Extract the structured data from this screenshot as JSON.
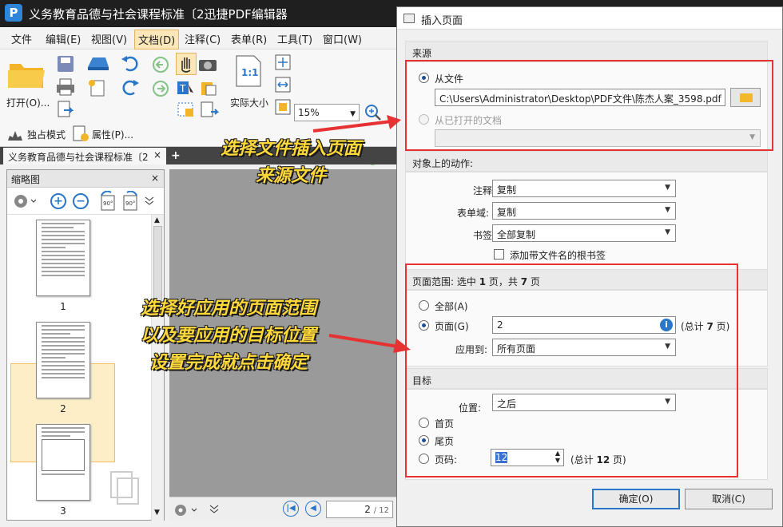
{
  "app": {
    "title": "义务教育品德与社会课程标准〔2迅捷PDF编辑器",
    "logo_glyph": "P"
  },
  "menu": [
    {
      "label": "文件"
    },
    {
      "label": "编辑(E)"
    },
    {
      "label": "视图(V)"
    },
    {
      "label": "文档(D)"
    },
    {
      "label": "注释(C)"
    },
    {
      "label": "表单(R)"
    },
    {
      "label": "工具(T)"
    },
    {
      "label": "窗口(W)"
    }
  ],
  "ribbon": {
    "open_label": "打开(O)...",
    "actual_size_glyph": "1:1",
    "actual_size_label": "实际大小",
    "zoom_value": "15%",
    "zoom_in_label": "放大",
    "zoom_out_label": "缩小",
    "exclusive_mode_label": "独占模式",
    "properties_label": "属性(P)..."
  },
  "doc_tab": {
    "label": "义务教育品德与社会课程标准〔2",
    "close": "×",
    "new_tab": "+"
  },
  "thumbnail_pane": {
    "title": "缩略图",
    "close": "×",
    "pages": [
      {
        "num": "1"
      },
      {
        "num": "2"
      },
      {
        "num": "3"
      }
    ]
  },
  "bottom_bar": {
    "page_current": "2",
    "page_total": "/ 12"
  },
  "dialog": {
    "title": "插入页面",
    "source": {
      "header": "来源",
      "from_file_label": "从文件",
      "file_path": "C:\\Users\\Administrator\\Desktop\\PDF文件\\陈杰人案_3598.pdf",
      "from_open_label": "从已打开的文档"
    },
    "actions": {
      "header": "对象上的动作:",
      "annot_label": "注释:",
      "annot_value": "复制",
      "form_label": "表单域:",
      "form_value": "复制",
      "bookmark_label": "书签:",
      "bookmark_value": "全部复制",
      "root_bookmark_label": "添加带文件名的根书签"
    },
    "range": {
      "header_prefix": "页面范围: 选中 ",
      "header_sel": "1",
      "header_mid": " 页，共 ",
      "header_total": "7",
      "header_suffix": " 页",
      "all_label": "全部(A)",
      "pages_label": "页面(G)",
      "pages_value": "2",
      "pages_total_prefix": "(总计 ",
      "pages_total": "7",
      "pages_total_suffix": " 页)",
      "apply_label": "应用到:",
      "apply_value": "所有页面"
    },
    "target": {
      "header": "目标",
      "position_label": "位置:",
      "position_value": "之后",
      "first_label": "首页",
      "last_label": "尾页",
      "page_label": "页码:",
      "page_value": "12",
      "total_prefix": "(总计 ",
      "total": "12",
      "total_suffix": " 页)"
    },
    "ok_label": "确定(O)",
    "cancel_label": "取消(C)"
  },
  "annotations": {
    "callout1_line1": "选择文件插入页面",
    "callout1_line2": "来源文件",
    "callout2_line1": "选择好应用的页面范围",
    "callout2_line2": "以及要应用的目标位置",
    "callout2_line3": "设置完成就点击确定",
    "highlight_color": "#e63232",
    "callout_color": "#ffd83a"
  }
}
